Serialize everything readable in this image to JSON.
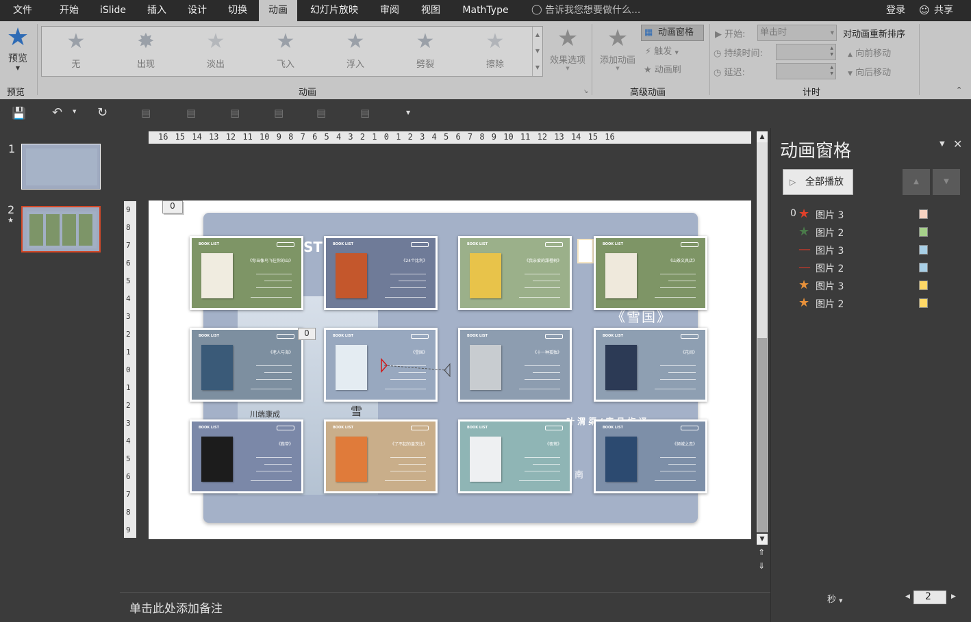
{
  "tabs": [
    {
      "label": "文件",
      "active": false
    },
    {
      "label": "开始",
      "active": false
    },
    {
      "label": "iSlide",
      "active": false
    },
    {
      "label": "插入",
      "active": false
    },
    {
      "label": "设计",
      "active": false
    },
    {
      "label": "切换",
      "active": false
    },
    {
      "label": "动画",
      "active": true
    },
    {
      "label": "幻灯片放映",
      "active": false
    },
    {
      "label": "审阅",
      "active": false
    },
    {
      "label": "视图",
      "active": false
    },
    {
      "label": "MathType",
      "active": false
    }
  ],
  "tell_me": "告诉我您想要做什么...",
  "login": "登录",
  "share": "共享",
  "ribbon": {
    "preview_label": "预览",
    "preview_group": "预览",
    "animations": [
      "无",
      "出现",
      "淡出",
      "飞入",
      "浮入",
      "劈裂",
      "擦除"
    ],
    "effect_options": "效果选项",
    "animation_group": "动画",
    "add_animation": "添加动画",
    "animation_pane": "动画窗格",
    "trigger": "触发",
    "animation_painter": "动画刷",
    "advanced_group": "高级动画",
    "start_label": "开始:",
    "start_value": "单击时",
    "duration_label": "持续时间:",
    "delay_label": "延迟:",
    "reorder_title": "对动画重新排序",
    "move_earlier": "向前移动",
    "move_later": "向后移动",
    "timing_group": "计时"
  },
  "slides": [
    "1",
    "2"
  ],
  "ruler_h": "16 15 14 13 12 11 10 9 8 7 6 5 4 3 2 1 0 1 2 3 4 5 6 7 8 9 10 11 12 13 14 15 16",
  "ruler_v": [
    "9",
    "8",
    "7",
    "6",
    "5",
    "4",
    "3",
    "2",
    "1",
    "0",
    "1",
    "2",
    "3",
    "4",
    "5",
    "6",
    "7",
    "8",
    "9"
  ],
  "slide": {
    "anim_marker_top": "0",
    "anim_marker_mid": "0",
    "bg_text": {
      "st": "ST",
      "snow": "《雪国》",
      "author": "川端康成",
      "snow_char": "雪",
      "translator": "叶 渭 渠 / 唐 月 梅 译",
      "nan": "南"
    },
    "cards": [
      {
        "label": "BOOK LIST",
        "title": "《你当像鸟飞往你的山》",
        "bg": "#7e9566",
        "cover": "#f0ece0"
      },
      {
        "label": "BOOK LIST",
        "title": "《24个比利》",
        "bg": "#6f7b98",
        "cover": "#c4572c"
      },
      {
        "label": "BOOK LIST",
        "title": "《我亲爱的甜橙树》",
        "bg": "#9bb08a",
        "cover": "#e8c34a"
      },
      {
        "label": "BOOK LIST",
        "title": "《山茶文具店》",
        "bg": "#7e9566",
        "cover": "#efe9dc"
      },
      {
        "label": "BOOK LIST",
        "title": "《老人与海》",
        "bg": "#7d8fa0",
        "cover": "#3a5a78"
      },
      {
        "label": "BOOK LIST",
        "title": "《雪国》",
        "bg": "#98a8bf",
        "cover": "#e4ecf2"
      },
      {
        "label": "BOOK LIST",
        "title": "《十一种孤独》",
        "bg": "#8d9db0",
        "cover": "#c8ccd0"
      },
      {
        "label": "BOOK LIST",
        "title": "《花间》",
        "bg": "#8e9fb2",
        "cover": "#2c3a55"
      },
      {
        "label": "BOOK LIST",
        "title": "《鞋带》",
        "bg": "#7b88a8",
        "cover": "#1c1c1c"
      },
      {
        "label": "BOOK LIST",
        "title": "《了不起的盖茨比》",
        "bg": "#c9ae8a",
        "cover": "#e07b3a"
      },
      {
        "label": "BOOK LIST",
        "title": "《夜莺》",
        "bg": "#8fb5b5",
        "cover": "#eef0f2"
      },
      {
        "label": "BOOK LIST",
        "title": "《倾城之恋》",
        "bg": "#7d8fa8",
        "cover": "#2c4a70"
      }
    ]
  },
  "notes_placeholder": "单击此处添加备注",
  "anim_pane": {
    "title": "动画窗格",
    "play_all": "全部播放",
    "items": [
      {
        "index": "0",
        "name": "图片 3",
        "icon": "star-red-icon",
        "color": "#f6d2c0"
      },
      {
        "index": "",
        "name": "图片 2",
        "icon": "star-green-icon",
        "color": "#a6d08a"
      },
      {
        "index": "",
        "name": "图片 3",
        "icon": "motion-path-icon",
        "color": "#a8cfe6"
      },
      {
        "index": "",
        "name": "图片 2",
        "icon": "motion-path-icon",
        "color": "#a8cfe6"
      },
      {
        "index": "",
        "name": "图片 3",
        "icon": "star-orange-icon",
        "color": "#ffd866"
      },
      {
        "index": "",
        "name": "图片 2",
        "icon": "star-orange-icon",
        "color": "#ffd866"
      }
    ],
    "seconds_label": "秒",
    "page_number": "2"
  }
}
